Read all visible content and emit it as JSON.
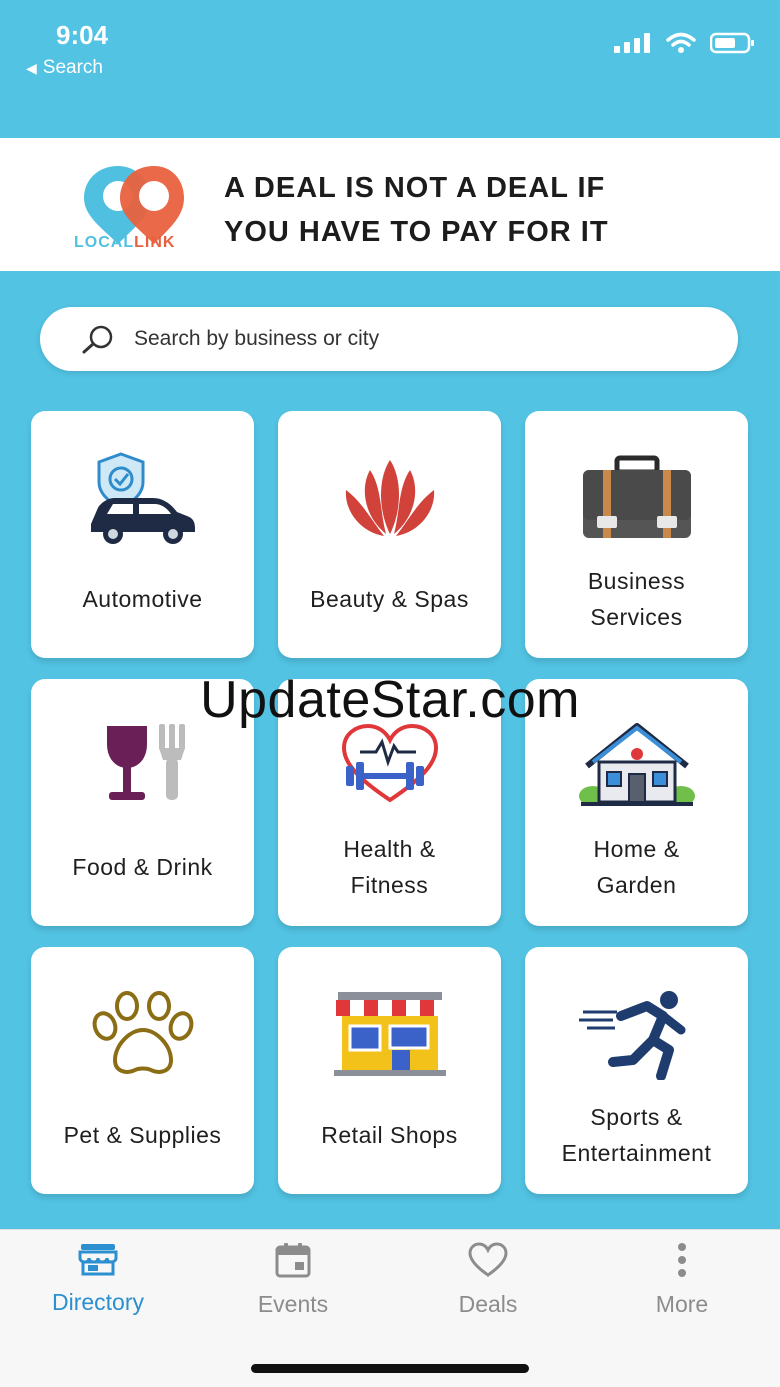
{
  "status": {
    "time": "9:04",
    "back_label": "Search"
  },
  "banner": {
    "logo_word1": "LOCAL",
    "logo_word2": "LINK",
    "tagline_line1": "A DEAL IS NOT A DEAL IF",
    "tagline_line2": "YOU HAVE TO PAY FOR IT"
  },
  "search": {
    "placeholder": "Search by business or city"
  },
  "categories": [
    {
      "line1": "Automotive",
      "line2": "",
      "icon": "car-shield-icon"
    },
    {
      "line1": "Beauty & Spas",
      "line2": "",
      "icon": "lotus-icon"
    },
    {
      "line1": "Business",
      "line2": "Services",
      "icon": "briefcase-icon"
    },
    {
      "line1": "Food & Drink",
      "line2": "",
      "icon": "wine-fork-icon"
    },
    {
      "line1": "Health &",
      "line2": "Fitness",
      "icon": "heart-dumbbell-icon"
    },
    {
      "line1": "Home &",
      "line2": "Garden",
      "icon": "house-icon"
    },
    {
      "line1": "Pet & Supplies",
      "line2": "",
      "icon": "paw-icon"
    },
    {
      "line1": "Retail Shops",
      "line2": "",
      "icon": "storefront-icon"
    },
    {
      "line1": "Sports &",
      "line2": "Entertainment",
      "icon": "runner-icon"
    }
  ],
  "watermark": "UpdateStar.com",
  "tabs": [
    {
      "label": "Directory",
      "icon": "store-icon",
      "active": true
    },
    {
      "label": "Events",
      "icon": "calendar-icon",
      "active": false
    },
    {
      "label": "Deals",
      "icon": "heart-icon",
      "active": false
    },
    {
      "label": "More",
      "icon": "more-vertical-icon",
      "active": false
    }
  ],
  "colors": {
    "background": "#52c3e3",
    "active_tab": "#2b8fd0",
    "inactive_tab": "#8c8c8c",
    "logo_blue": "#4fc0e0",
    "logo_orange": "#e8613f"
  }
}
